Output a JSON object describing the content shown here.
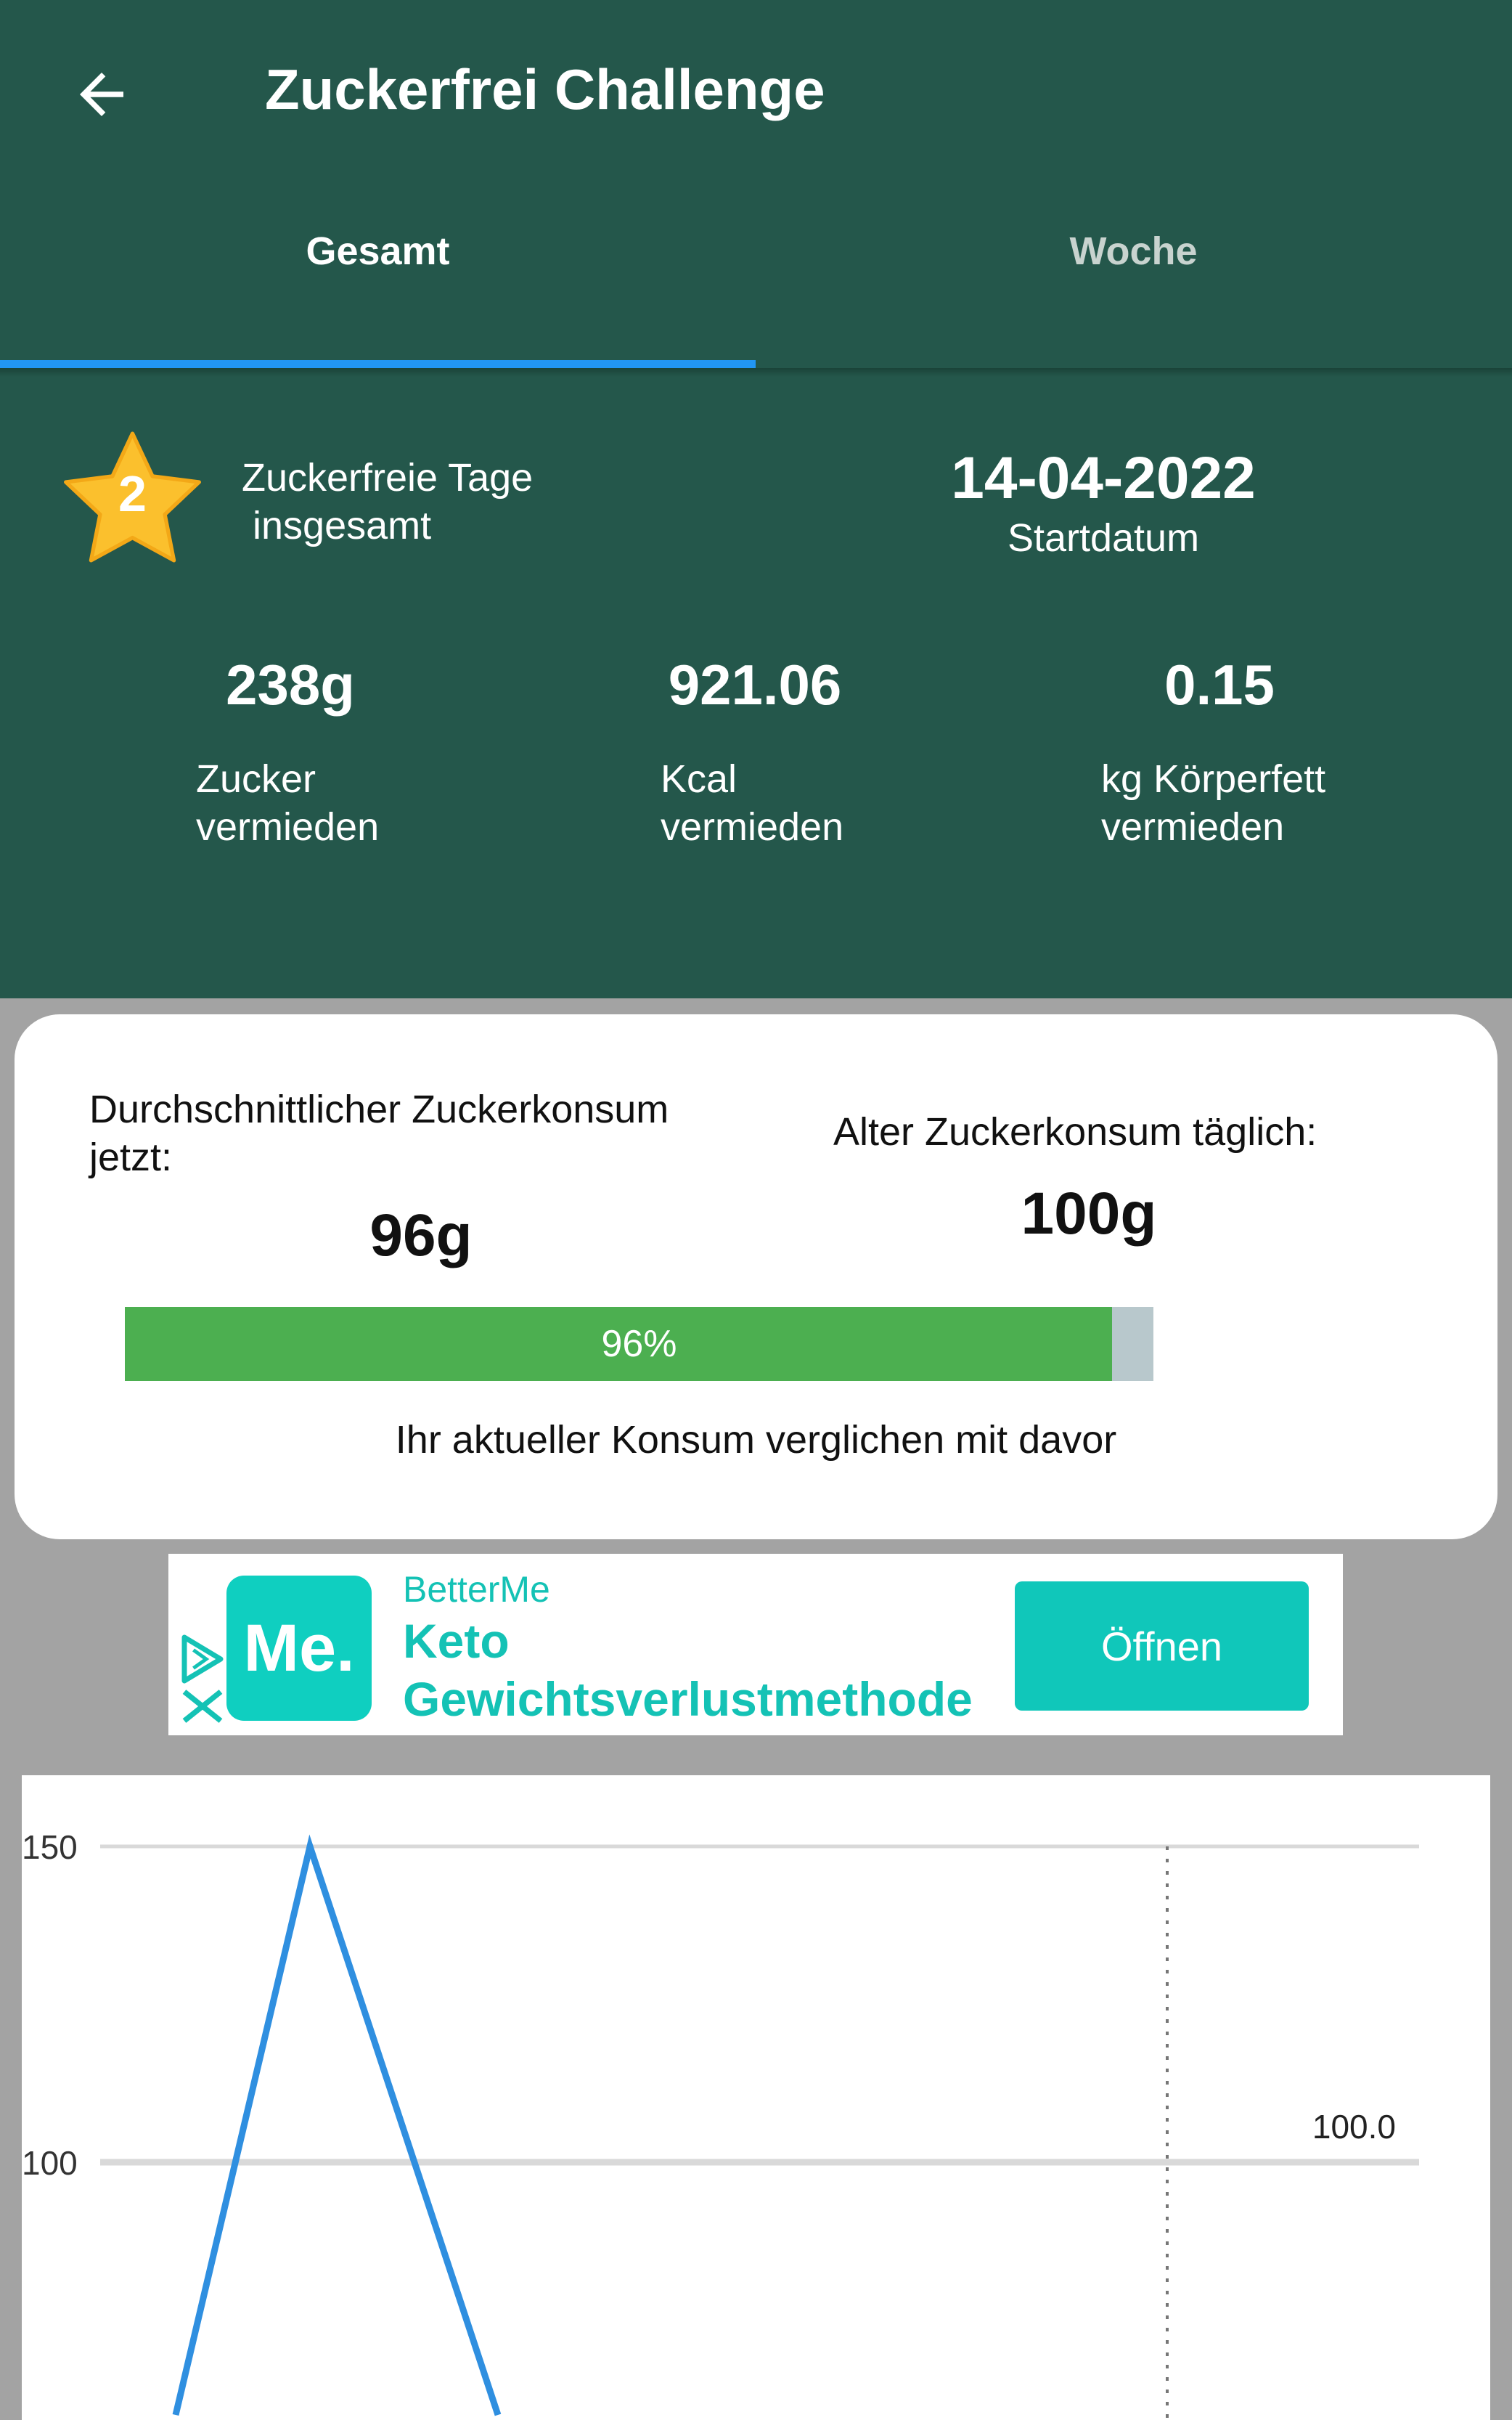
{
  "appbar": {
    "title": "Zuckerfrei Challenge",
    "back_icon": "arrow-left-icon"
  },
  "tabs": [
    {
      "label": "Gesamt",
      "active": true
    },
    {
      "label": "Woche",
      "active": false
    }
  ],
  "summary": {
    "days_count": "2",
    "days_label": "Zuckerfreie Tage\n insgesamt",
    "start_date": "14-04-2022",
    "start_date_label": "Startdatum",
    "stats": [
      {
        "value": "238g",
        "label": "Zucker\nvermieden"
      },
      {
        "value": "921.06",
        "label": "Kcal\nvermieden"
      },
      {
        "value": "0.15",
        "label": "kg Körperfett\nvermieden"
      }
    ]
  },
  "consumption": {
    "now_label": "Durchschnittlicher Zuckerkonsum jetzt:",
    "now_value": "96g",
    "old_label": "Alter Zuckerkonsum täglich:",
    "old_value": "100g",
    "progress_percent": 96,
    "progress_text": "96%",
    "compare_label": "Ihr aktueller Konsum verglichen mit davor"
  },
  "ad": {
    "brand": "BetterMe",
    "logo_text": "Me.",
    "headline_1": "Keto",
    "headline_2": "Gewichtsverlustmethode",
    "button_label": "Öffnen"
  },
  "colors": {
    "header_bg": "#24574b",
    "tab_indicator": "#2196f3",
    "progress_fill": "#4caf50",
    "progress_track": "#b8c8cc",
    "line": "#2f8fe0",
    "ad_accent": "#10c7ba",
    "star": "#fbc02d"
  },
  "chart_data": {
    "type": "line",
    "yticks": [
      150,
      100
    ],
    "ref_line": {
      "value": 100,
      "label": "100.0"
    },
    "series": [
      {
        "points": [
          [
            0,
            60
          ],
          [
            1,
            150
          ],
          [
            2.4,
            60
          ]
        ]
      }
    ],
    "grid": true
  }
}
